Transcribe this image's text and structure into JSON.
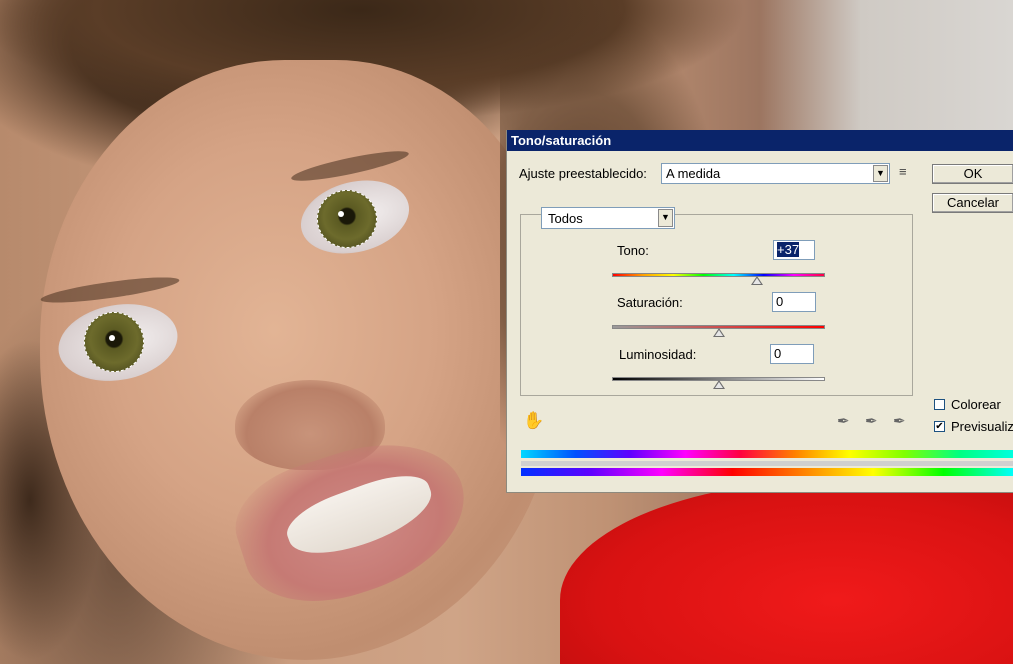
{
  "dialog": {
    "title": "Tono/saturación",
    "preset_label": "Ajuste preestablecido:",
    "preset_value": "A medida",
    "ok_label": "OK",
    "cancel_label": "Cancelar",
    "channel_value": "Todos",
    "hue": {
      "label": "Tono:",
      "value": "+37",
      "slider_percent": 68
    },
    "saturation": {
      "label": "Saturación:",
      "value": "0",
      "slider_percent": 50
    },
    "lightness": {
      "label": "Luminosidad:",
      "value": "0",
      "slider_percent": 50
    },
    "colorize_label": "Colorear",
    "colorize_checked": false,
    "preview_label": "Previsualiza",
    "preview_checked": true,
    "icons": {
      "preset_menu": "preset-options-icon",
      "targeted_adjust": "targeted-adjustment-hand-icon",
      "eyedropper": "eyedropper-icon",
      "eyedropper_add": "eyedropper-plus-icon",
      "eyedropper_subtract": "eyedropper-minus-icon"
    }
  },
  "colors": {
    "titlebar": "#0a246a",
    "dialog_bg": "#ece9d8"
  }
}
